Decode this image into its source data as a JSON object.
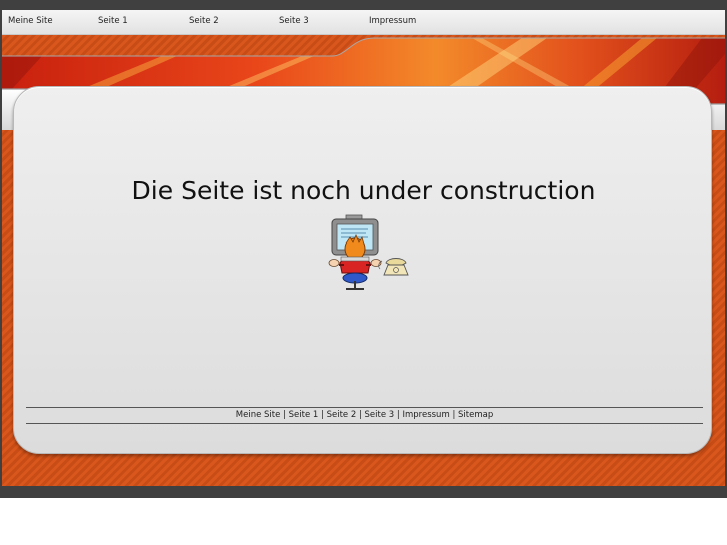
{
  "nav": {
    "items": [
      {
        "label": "Meine Site"
      },
      {
        "label": "Seite 1"
      },
      {
        "label": "Seite 2"
      },
      {
        "label": "Seite 3"
      },
      {
        "label": "Impressum"
      }
    ]
  },
  "main": {
    "heading": "Die Seite ist noch under construction",
    "illustration_icon": "person-at-computer-icon"
  },
  "footer": {
    "links": [
      {
        "label": "Meine Site"
      },
      {
        "label": "Seite 1"
      },
      {
        "label": "Seite 2"
      },
      {
        "label": "Seite 3"
      },
      {
        "label": "Impressum"
      },
      {
        "label": "Sitemap"
      }
    ],
    "separator": "|"
  },
  "colors": {
    "banner_orange": "#e8501a",
    "frame_orange": "#d9571d",
    "outer_dark": "#404040",
    "card_gray": "#e6e6e6"
  }
}
